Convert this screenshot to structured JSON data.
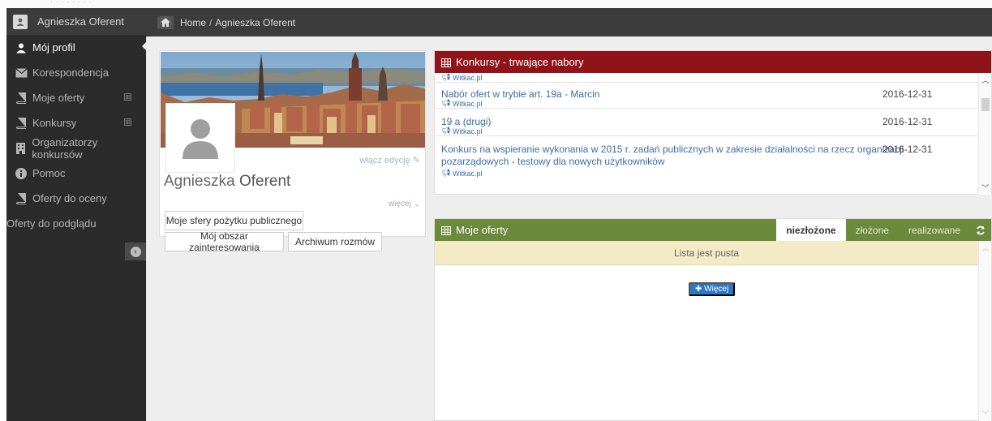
{
  "app": {
    "user_name": "Agnieszka Oferent",
    "accent_red": "#8f1318",
    "accent_green": "#6b8a3c"
  },
  "sidebar": {
    "items": [
      {
        "label": "Mój profil",
        "icon": "user-icon"
      },
      {
        "label": "Korespondencja",
        "icon": "envelope-icon"
      },
      {
        "label": "Moje oferty",
        "icon": "book-icon",
        "expandable": "⊞"
      },
      {
        "label": "Konkursy",
        "icon": "book-icon",
        "expandable": "⊞"
      },
      {
        "label": "Organizatorzy konkursów",
        "icon": "building-icon"
      },
      {
        "label": "Pomoc",
        "icon": "info-icon"
      },
      {
        "label": "Oferty do oceny",
        "icon": "book-icon"
      },
      {
        "label": "Oferty do podglądu",
        "icon": ""
      }
    ]
  },
  "breadcrumb": {
    "home": "Home",
    "separator": "/",
    "current": "Agnieszka Oferent"
  },
  "profile": {
    "edit_link": "włącz edycję",
    "first_name": "Agnieszka",
    "last_name": "Oferent",
    "more_link": "więcej",
    "buttons": {
      "spheres": "Moje sfery pożytku publicznego",
      "interests": "Mój obszar zainteresowania",
      "archive": "Archiwum rozmów"
    }
  },
  "contests": {
    "title": "Konkursy - trwające nabory",
    "rows": [
      {
        "title": "",
        "source": "Witkac.pl",
        "date": ""
      },
      {
        "title": "Nabór ofert w trybie art. 19a - Marcin",
        "source": "Witkac.pl",
        "date": "2016-12-31"
      },
      {
        "title": "19 a (drugi)",
        "source": "Witkac.pl",
        "date": "2016-12-31"
      },
      {
        "title_line1": "Konkurs na wspieranie wykonania w 2015 r. zadań publicznych w zakresie działalności na rzecz organizacji",
        "title_line2": "pozarządowych - testowy dla nowych użytkowników",
        "source": "Witkac.pl",
        "date": "2016-12-31"
      }
    ]
  },
  "offers": {
    "title": "Moje oferty",
    "tabs": [
      "niezłożone",
      "złożone",
      "realizowane"
    ],
    "empty_text": "Lista jest pusta",
    "more_button": "Więcej"
  }
}
